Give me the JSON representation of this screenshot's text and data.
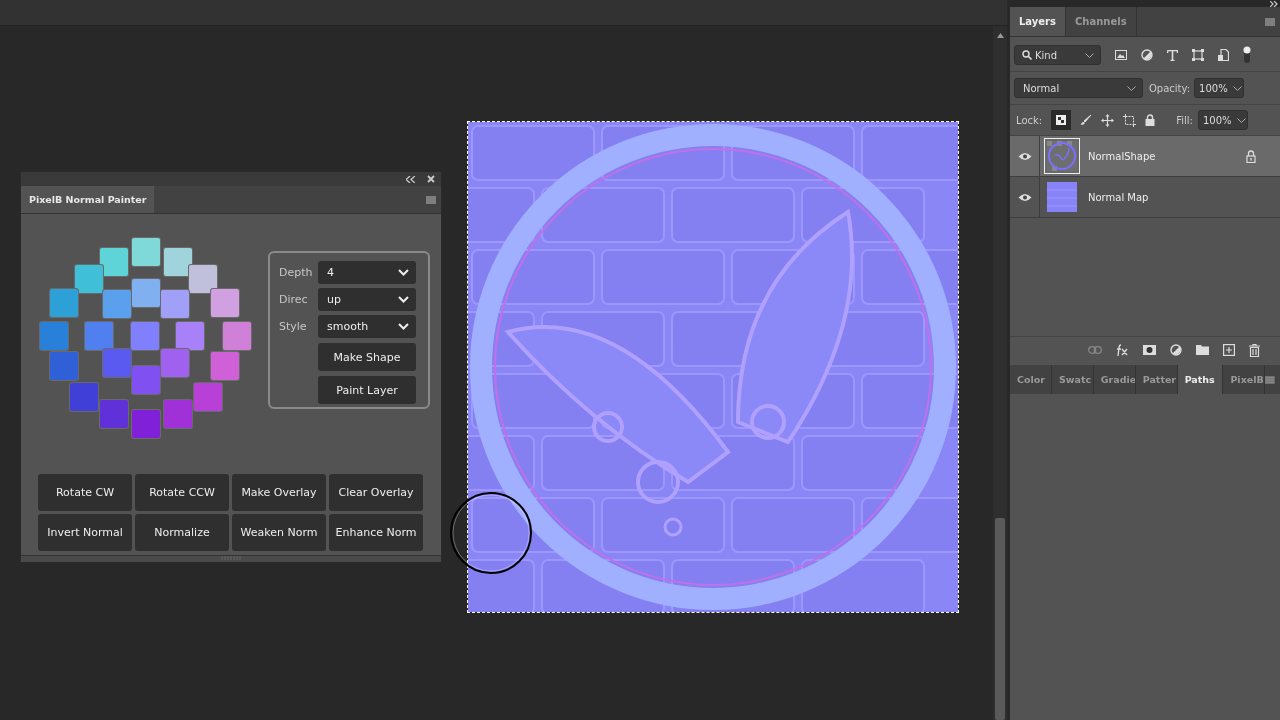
{
  "plugin_panel": {
    "title": "PixelB Normal Painter",
    "swatches": [
      {
        "color": "#7fd9d9"
      },
      {
        "color": "#5ed3d8"
      },
      {
        "color": "#a0d4dc"
      },
      {
        "color": "#40c0d8"
      },
      {
        "color": "#c0c0dc"
      },
      {
        "color": "#2ea0d8"
      },
      {
        "color": "#5aa0ec"
      },
      {
        "color": "#80b0f0"
      },
      {
        "color": "#a0a0f8"
      },
      {
        "color": "#d0a0e0"
      },
      {
        "color": "#2880d8"
      },
      {
        "color": "#5080f0"
      },
      {
        "color": "#8080ff"
      },
      {
        "color": "#a880f8"
      },
      {
        "color": "#d080d8"
      },
      {
        "color": "#3060d8"
      },
      {
        "color": "#5a5af0"
      },
      {
        "color": "#a060f0"
      },
      {
        "color": "#d060d8"
      },
      {
        "color": "#8050f0"
      },
      {
        "color": "#4040d8"
      },
      {
        "color": "#b840d8"
      },
      {
        "color": "#6030d8"
      },
      {
        "color": "#a030d8"
      },
      {
        "color": "#8020d8"
      }
    ],
    "options": [
      {
        "label": "Depth",
        "value": "4"
      },
      {
        "label": "Direc",
        "value": "up"
      },
      {
        "label": "Style",
        "value": "smooth"
      }
    ],
    "side_buttons": [
      "Make Shape",
      "Paint Layer"
    ],
    "buttons": [
      "Rotate CW",
      "Rotate CCW",
      "Make Overlay",
      "Clear Overlay",
      "Invert Normal",
      "Normalize",
      "Weaken Norm",
      "Enhance Norm"
    ]
  },
  "layers_panel": {
    "tabs": [
      {
        "label": "Layers",
        "selected": true
      },
      {
        "label": "Channels",
        "selected": false
      }
    ],
    "filter": "Kind",
    "blend_mode": "Normal",
    "opacity_label": "Opacity:",
    "opacity": "100%",
    "lock_label": "Lock:",
    "fill_label": "Fill:",
    "fill": "100%",
    "layers": [
      {
        "name": "NormalShape",
        "selected": true,
        "visible": true,
        "locked": true,
        "kind": "shape"
      },
      {
        "name": "Normal Map",
        "selected": false,
        "visible": true,
        "locked": false,
        "kind": "map"
      }
    ]
  },
  "bottom_tabs": [
    {
      "label": "Color",
      "selected": false
    },
    {
      "label": "Swatc",
      "selected": false
    },
    {
      "label": "Gradie",
      "selected": false
    },
    {
      "label": "Patter",
      "selected": false
    },
    {
      "label": "Paths",
      "selected": true
    },
    {
      "label": "PixelB",
      "selected": false
    }
  ]
}
